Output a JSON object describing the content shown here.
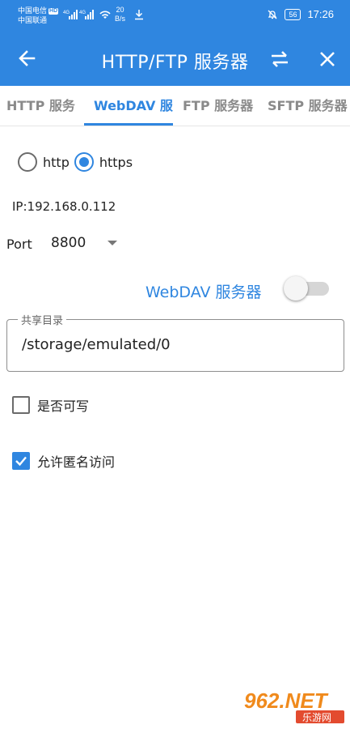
{
  "status_bar": {
    "carrier1": "中国电信",
    "carrier1_badge": "HD",
    "carrier2": "中国联通",
    "net1": "4G",
    "net2": "4G",
    "speed_value": "20",
    "speed_unit": "B/s",
    "battery": "56",
    "time": "17:26"
  },
  "appbar": {
    "title": "HTTP/FTP 服务器"
  },
  "tabs": [
    {
      "label": "HTTP 服务"
    },
    {
      "label": "WebDAV 服"
    },
    {
      "label": "FTP 服务器"
    },
    {
      "label": "SFTP 服务器"
    }
  ],
  "protocol": {
    "options": [
      "http",
      "https"
    ],
    "selected": "https"
  },
  "ip_text": "IP:192.168.0.112",
  "port": {
    "label": "Port",
    "value": "8800"
  },
  "server_switch": {
    "label": "WebDAV 服务器",
    "on": false
  },
  "shared_dir": {
    "legend": "共享目录",
    "value": "/storage/emulated/0"
  },
  "options": {
    "writable_label": "是否可写",
    "writable_checked": false,
    "anonymous_label": "允许匿名访问",
    "anonymous_checked": true
  },
  "watermark": {
    "logo": "962.NET",
    "subtitle": "乐游网"
  },
  "colors": {
    "primary": "#2f86e0"
  }
}
